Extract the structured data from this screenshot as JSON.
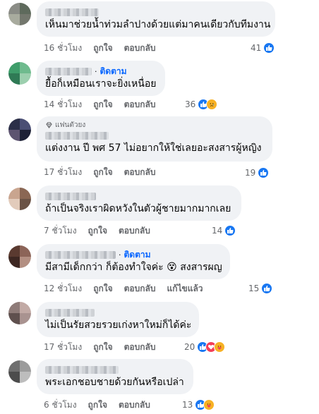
{
  "comments": [
    {
      "follow": "",
      "badge": "",
      "text": "เห็นมาช่วยน้ำท่วมลำปางด้วยแต่มาคนเดียวกับทีมงาน",
      "time": "16 ชั่วโมง",
      "like": "ถูกใจ",
      "reply": "ตอบกลับ",
      "edited": "",
      "reaction_count": "41",
      "reactions": [
        "like"
      ],
      "avatar_colors": [
        "#8a8c86",
        "#5e6a5c",
        "#a8ab9e",
        "#73776d"
      ]
    },
    {
      "follow": "ติดตาม",
      "badge": "",
      "text": "ยื้อก็เหมือนเราจะยิ่งเหนื่อย",
      "time": "14 ชั่วโมง",
      "like": "ถูกใจ",
      "reply": "ตอบกลับ",
      "edited": "",
      "reaction_count": "36",
      "reactions": [
        "like",
        "sad"
      ],
      "avatar_colors": [
        "#3e9d6a",
        "#6fbb8e",
        "#2f7a55",
        "#9ccfae"
      ]
    },
    {
      "follow": "",
      "badge": "แฟนตัวยง",
      "text": "แต่งงาน ปี พศ 57 ไม่อยากให้ใช่เลยอะสงสารผู้หญิง",
      "time": "17 ชั่วโมง",
      "like": "ถูกใจ",
      "reply": "ตอบกลับ",
      "edited": "",
      "reaction_count": "19",
      "reactions": [
        "like"
      ],
      "avatar_colors": [
        "#2b2f48",
        "#4a4e74",
        "#5d5470",
        "#1d2136"
      ]
    },
    {
      "follow": "",
      "badge": "",
      "text": "ถ้าเป็นจริงเราผิดหวังในตัวผู้ชายมากมากเลย",
      "time": "7 ชั่วโมง",
      "like": "ถูกใจ",
      "reply": "ตอบกลับ",
      "edited": "",
      "reaction_count": "14",
      "reactions": [
        "like"
      ],
      "avatar_colors": [
        "#c9a58f",
        "#8a6754",
        "#e2cbbb",
        "#6b5346"
      ]
    },
    {
      "follow": "ติดตาม",
      "badge": "",
      "text": "มีสามีเด็กกว่า ก็ต้องทำใจค่ะ 😵 สงสารผญ",
      "time": "12 ชั่วโมง",
      "like": "ถูกใจ",
      "reply": "ตอบกลับ",
      "edited": "แก้ไขแล้ว",
      "reaction_count": "15",
      "reactions": [
        "like"
      ],
      "avatar_colors": [
        "#5a3a30",
        "#8c6458",
        "#3d2722",
        "#b38f82"
      ]
    },
    {
      "follow": "",
      "badge": "",
      "text": "ไม่เป็นรัยสวยรวยเก่งหาใหม่ก็ได้ค่ะ",
      "time": "17 ชั่วโมง",
      "like": "ถูกใจ",
      "reply": "ตอบกลับ",
      "edited": "",
      "reaction_count": "20",
      "reactions": [
        "like",
        "love",
        "care"
      ],
      "avatar_colors": [
        "#8e7b78",
        "#c2aaa5",
        "#5f504e",
        "#a99390"
      ]
    },
    {
      "follow": "",
      "badge": "",
      "text": "พระเอกชอบชายด้วยกันหรือเปล่า",
      "time": "6 ชั่วโมง",
      "like": "ถูกใจ",
      "reply": "ตอบกลับ",
      "edited": "",
      "reaction_count": "13",
      "reactions": [
        "like",
        "care"
      ],
      "avatar_colors": [
        "#6f6f6f",
        "#9c9c9c",
        "#4c4c4c",
        "#bdbdbd"
      ]
    }
  ]
}
